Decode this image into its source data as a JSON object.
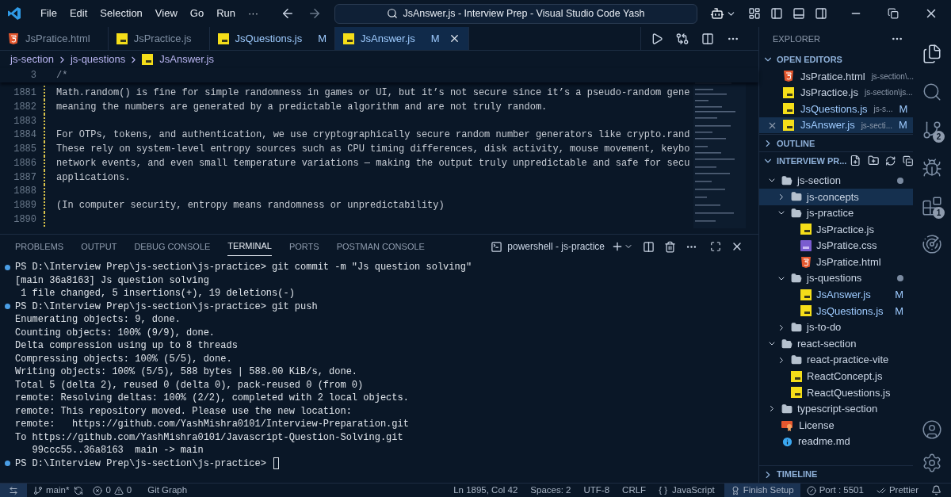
{
  "title_bar": {
    "menu": [
      "File",
      "Edit",
      "Selection",
      "View",
      "Go",
      "Run",
      "···"
    ],
    "command_center": "JsAnswer.js - Interview Prep - Visual Studio Code Yash"
  },
  "tabs": [
    {
      "label": "JsPratice.html",
      "kind": "html",
      "selected": false
    },
    {
      "label": "JsPractice.js",
      "kind": "js",
      "selected": false
    },
    {
      "label": "JsQuestions.js",
      "kind": "js",
      "status": "M",
      "selected": false
    },
    {
      "label": "JsAnswer.js",
      "kind": "js",
      "status": "M",
      "selected": true
    }
  ],
  "breadcrumb": [
    "js-section",
    "js-questions",
    "JsAnswer.js"
  ],
  "editor": {
    "sticky": {
      "number": "3",
      "text": "/*"
    },
    "lines": [
      {
        "number": "1881",
        "text": "Math.random() is fine for simple randomness in games or UI, but it’s not secure since it’s a pseudo-random gene"
      },
      {
        "number": "1882",
        "text": "meaning the numbers are generated by a predictable algorithm and are not truly random."
      },
      {
        "number": "1883"
      },
      {
        "number": "1884",
        "text": "For OTPs, tokens, and authentication, we use cryptographically secure random number generators like crypto.rand"
      },
      {
        "number": "1885",
        "text": "These rely on system-level entropy sources such as CPU timing differences, disk activity, mouse movement, keybo"
      },
      {
        "number": "1886",
        "text": "network events, and even small temperature variations — making the output truly unpredictable and safe for secu"
      },
      {
        "number": "1887",
        "text": "applications."
      },
      {
        "number": "1888"
      },
      {
        "number": "1889",
        "text": "(In computer security, entropy means randomness or unpredictability)"
      },
      {
        "number": "1890"
      }
    ]
  },
  "panel": {
    "tabs": [
      {
        "label": "PROBLEMS",
        "selected": false
      },
      {
        "label": "OUTPUT",
        "selected": false
      },
      {
        "label": "DEBUG CONSOLE",
        "selected": false
      },
      {
        "label": "TERMINAL",
        "selected": true
      },
      {
        "label": "PORTS",
        "selected": false
      },
      {
        "label": "POSTMAN CONSOLE",
        "selected": false
      }
    ],
    "terminal_name": "powershell - js-practice",
    "lines": [
      {
        "kind": "prompt",
        "text": "PS D:\\Interview Prep\\js-section\\js-practice> git commit -m \"Js question solving\""
      },
      {
        "kind": "output",
        "text": "[main 36a8163] Js question solving"
      },
      {
        "kind": "output",
        "text": " 1 file changed, 5 insertions(+), 19 deletions(-)"
      },
      {
        "kind": "prompt",
        "text": "PS D:\\Interview Prep\\js-section\\js-practice> git push"
      },
      {
        "kind": "output",
        "text": "Enumerating objects: 9, done."
      },
      {
        "kind": "output",
        "text": "Counting objects: 100% (9/9), done."
      },
      {
        "kind": "output",
        "text": "Delta compression using up to 8 threads"
      },
      {
        "kind": "output",
        "text": "Compressing objects: 100% (5/5), done."
      },
      {
        "kind": "output",
        "text": "Writing objects: 100% (5/5), 588 bytes | 588.00 KiB/s, done."
      },
      {
        "kind": "output",
        "text": "Total 5 (delta 2), reused 0 (delta 0), pack-reused 0 (from 0)"
      },
      {
        "kind": "output",
        "text": "remote: Resolving deltas: 100% (2/2), completed with 2 local objects."
      },
      {
        "kind": "output",
        "text": "remote: This repository moved. Please use the new location:"
      },
      {
        "kind": "output",
        "text": "remote:   https://github.com/YashMishra0101/Interview-Preparation.git"
      },
      {
        "kind": "output",
        "text": "To https://github.com/YashMishra0101/Javascript-Question-Solving.git"
      },
      {
        "kind": "output",
        "text": "   99ccc55..36a8163  main -> main"
      },
      {
        "kind": "prompt",
        "text": "PS D:\\Interview Prep\\js-section\\js-practice> "
      }
    ]
  },
  "sidebar": {
    "title": "EXPLORER",
    "open_editors": {
      "label": "OPEN EDITORS",
      "expanded": true,
      "items": [
        {
          "name": "JsPratice.html",
          "path": "js-section\\...",
          "kind": "html",
          "selected": false
        },
        {
          "name": "JsPractice.js",
          "path": "js-section\\js...",
          "kind": "js",
          "selected": false
        },
        {
          "name": "JsQuestions.js",
          "path": "js-s...",
          "kind": "js",
          "status": "M",
          "selected": false
        },
        {
          "name": "JsAnswer.js",
          "path": "js-secti...",
          "kind": "js",
          "status": "M",
          "selected": true
        }
      ]
    },
    "outline": {
      "label": "OUTLINE",
      "expanded": false
    },
    "project": {
      "label": "INTERVIEW PR...",
      "expanded": true,
      "tree": [
        {
          "name": "js-section",
          "kind": "folder",
          "expanded": true,
          "dot": true,
          "selected": false,
          "children": [
            {
              "name": "js-concepts",
              "kind": "folder",
              "expanded": false,
              "dot": false,
              "selected": true
            },
            {
              "name": "js-practice",
              "kind": "folder",
              "expanded": true,
              "dot": false,
              "selected": false,
              "children": [
                {
                  "name": "JsPractice.js",
                  "kind": "js",
                  "selected": false
                },
                {
                  "name": "JsPratice.css",
                  "kind": "css",
                  "selected": false
                },
                {
                  "name": "JsPratice.html",
                  "kind": "html",
                  "selected": false
                }
              ]
            },
            {
              "name": "js-questions",
              "kind": "folder",
              "expanded": true,
              "dot": true,
              "selected": false,
              "children": [
                {
                  "name": "JsAnswer.js",
                  "kind": "js",
                  "status": "M",
                  "selected": false
                },
                {
                  "name": "JsQuestions.js",
                  "kind": "js",
                  "status": "M",
                  "selected": false
                }
              ]
            },
            {
              "name": "js-to-do",
              "kind": "folder",
              "expanded": false,
              "dot": false,
              "selected": false
            }
          ]
        },
        {
          "name": "react-section",
          "kind": "folder",
          "expanded": true,
          "dot": false,
          "selected": false,
          "children": [
            {
              "name": "react-practice-vite",
              "kind": "folder",
              "expanded": false,
              "dot": false,
              "selected": false
            },
            {
              "name": "ReactConcept.js",
              "kind": "js",
              "selected": false
            },
            {
              "name": "ReactQuestions.js",
              "kind": "js",
              "selected": false
            }
          ]
        },
        {
          "name": "typescript-section",
          "kind": "folder",
          "expanded": false,
          "dot": false,
          "selected": false
        },
        {
          "name": "License",
          "kind": "license",
          "selected": false
        },
        {
          "name": "readme.md",
          "kind": "info",
          "selected": false
        }
      ]
    },
    "timeline": {
      "label": "TIMELINE",
      "expanded": false
    }
  },
  "activity_bar": [
    {
      "kind": "explorer",
      "selected": true
    },
    {
      "kind": "search",
      "selected": false
    },
    {
      "kind": "source-control",
      "badge": "2",
      "selected": false
    },
    {
      "kind": "debug",
      "selected": false
    },
    {
      "kind": "extensions",
      "badge": "1",
      "selected": false
    },
    {
      "kind": "remote",
      "selected": false
    }
  ],
  "status_bar": {
    "branch": "main*",
    "errors": "0",
    "warnings": "0",
    "git_graph": "Git Graph",
    "position": "Ln 1895, Col 42",
    "spaces": "Spaces: 2",
    "encoding": "UTF-8",
    "eol": "CRLF",
    "language_icon": "{ }",
    "language": "JavaScript",
    "setup": "Finish Setup",
    "port": "Port : 5501",
    "formatter": "Prettier"
  }
}
